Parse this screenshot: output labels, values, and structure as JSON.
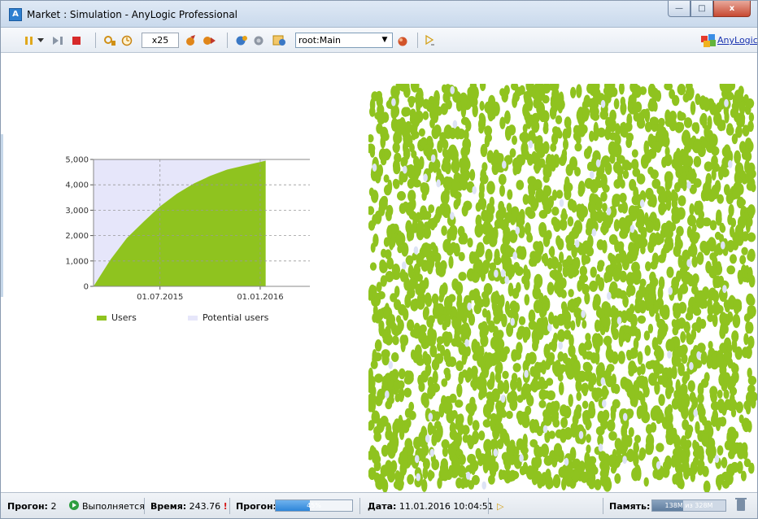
{
  "window": {
    "title": "Market : Simulation - AnyLogic Professional",
    "app_icon_glyph": "A",
    "minimize_glyph": "—",
    "maximize_glyph": "□",
    "close_glyph": "x"
  },
  "toolbar": {
    "speed": "x25",
    "root_combo": "root:Main",
    "combo_arrow": "▼",
    "brand_link": "AnyLogic",
    "icons": [
      "pause-icon",
      "step-dropdown-icon",
      "step-icon",
      "stop-icon",
      "run-until-icon",
      "time-mode-icon",
      "slower-icon",
      "faster-icon",
      "navigate-icon",
      "view-icon",
      "navigate-agent-icon",
      "target-icon",
      "console-icon"
    ]
  },
  "chart_data": {
    "type": "area",
    "title": "",
    "xlabel": "",
    "ylabel": "",
    "ylim": [
      0,
      5000
    ],
    "yticks": [
      "0",
      "1,000",
      "2,000",
      "3,000",
      "4,000",
      "5,000"
    ],
    "xticks": [
      "01.07.2015",
      "01.01.2016"
    ],
    "x_range": [
      "01.03.2015",
      "01.05.2016"
    ],
    "grid": true,
    "legend_placement": "bottom",
    "stacked": true,
    "x": [
      "01.03.2015",
      "01.04.2015",
      "01.05.2015",
      "01.06.2015",
      "01.07.2015",
      "01.08.2015",
      "01.09.2015",
      "01.10.2015",
      "01.11.2015",
      "01.12.2015",
      "01.01.2016",
      "11.01.2016"
    ],
    "series": [
      {
        "name": "Users",
        "color": "#8fc31f",
        "values": [
          0,
          1050,
          1900,
          2550,
          3150,
          3650,
          4050,
          4350,
          4600,
          4750,
          4900,
          4950
        ]
      },
      {
        "name": "Potential users",
        "color": "#e6e6fa",
        "values": [
          5000,
          3950,
          3100,
          2450,
          1850,
          1350,
          950,
          650,
          400,
          250,
          100,
          50
        ]
      }
    ]
  },
  "agents": {
    "color_users": "#8fc31f",
    "color_potential": "#dde3f5"
  },
  "status": {
    "run_label": "Прогон:",
    "run_number": "2",
    "run_state": "Выполняется",
    "time_label": "Время:",
    "time_value": "243.76",
    "time_warn": "!",
    "progress_label": "Прогон:",
    "progress_percent": 45,
    "progress_text": "45%",
    "date_label": "Дата:",
    "date_value": "11.01.2016 10:04:51",
    "date_play_glyph": "▷",
    "memory_label": "Память:",
    "memory_used": "138M",
    "memory_separator": "из",
    "memory_total": "328M",
    "memory_fraction": 0.42
  }
}
